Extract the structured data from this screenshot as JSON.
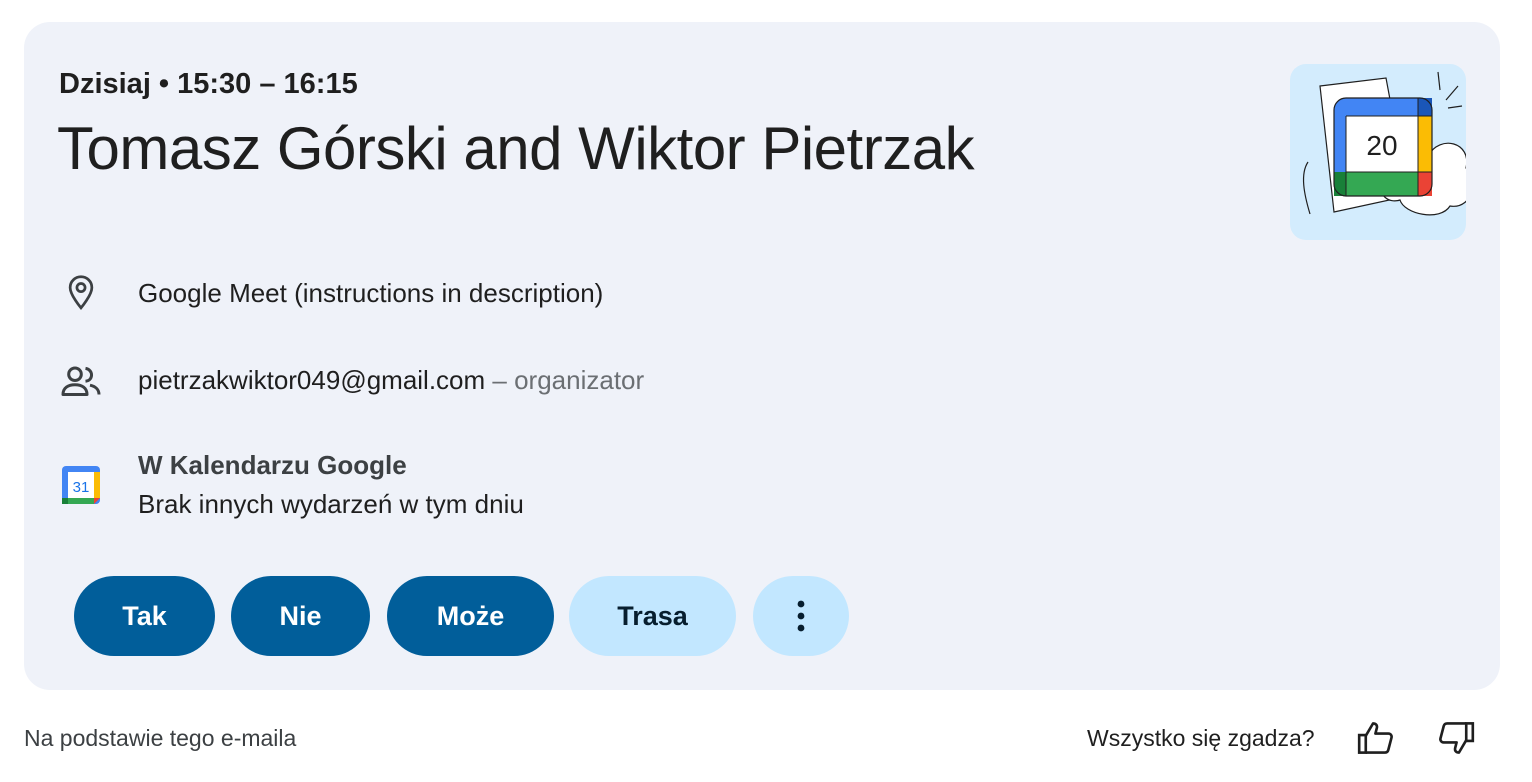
{
  "event": {
    "when": "Dzisiaj • 15:30 – 16:15",
    "title": "Tomasz Górski and Wiktor Pietrzak",
    "location": "Google Meet (instructions in description)",
    "organizer_email": "pietrzakwiktor049@gmail.com",
    "organizer_role": " – organizator",
    "calendar_title": "W Kalendarzu Google",
    "calendar_status": "Brak innych wydarzeń w tym dniu",
    "illustration_number": "20",
    "calendar_icon_number": "31"
  },
  "actions": {
    "yes": "Tak",
    "no": "Nie",
    "maybe": "Może",
    "route": "Trasa",
    "more_icon": "more-vert-icon"
  },
  "footer": {
    "source": "Na podstawie tego e-maila",
    "feedback_question": "Wszystko się zgadza?",
    "thumbs_up_icon": "thumbs-up-icon",
    "thumbs_down_icon": "thumbs-down-icon"
  },
  "colors": {
    "card_bg": "#eff2f9",
    "primary_button": "#015e9a",
    "tonal_button": "#c2e7ff",
    "google_blue": "#4285f4",
    "google_red": "#ea4335",
    "google_yellow": "#fbbc04",
    "google_green": "#34a853"
  }
}
